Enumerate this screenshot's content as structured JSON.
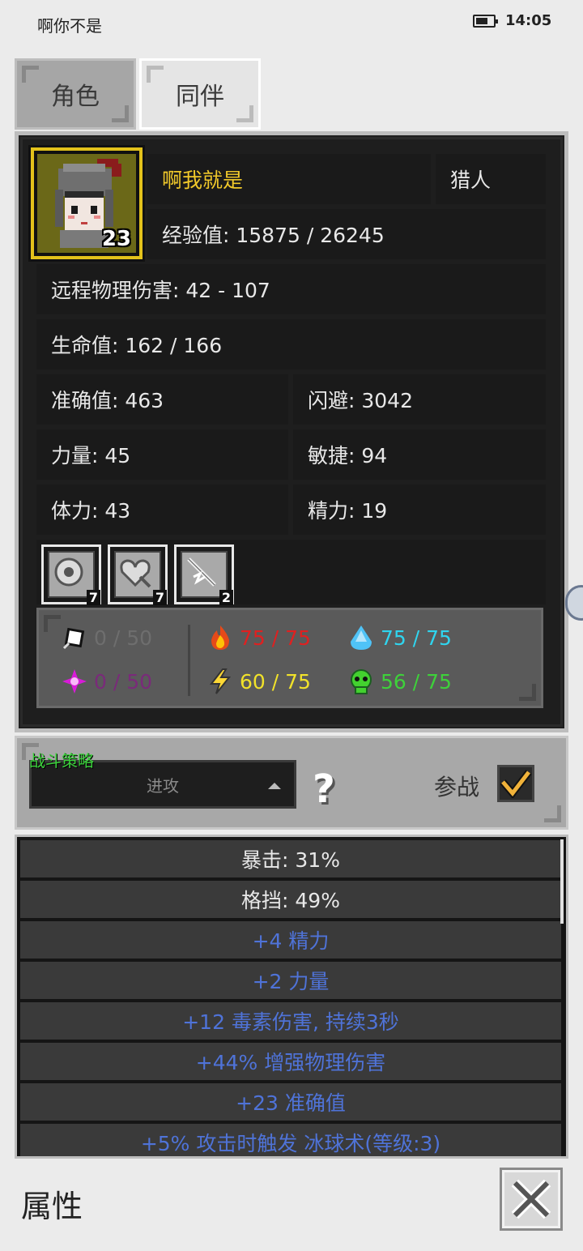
{
  "status_bar": {
    "title": "啊你不是",
    "time": "14:05",
    "battery_pct": 70
  },
  "tabs": [
    {
      "label": "角色",
      "active": false
    },
    {
      "label": "同伴",
      "active": true
    }
  ],
  "hero": {
    "name": "啊我就是",
    "class": "猎人",
    "level": "23",
    "experience": "经验值: 15875 / 26245",
    "ranged_damage": "远程物理伤害: 42 - 107",
    "hp": "生命值: 162 / 166"
  },
  "stats": {
    "accuracy": "准确值: 463",
    "evasion": "闪避: 3042",
    "strength": "力量: 45",
    "agility": "敏捷: 94",
    "vitality": "体力: 43",
    "energy": "精力: 19"
  },
  "skills": [
    {
      "icon": "shield-round-icon",
      "count": "7"
    },
    {
      "icon": "shield-heart-icon",
      "count": "7"
    },
    {
      "icon": "sword-lightning-icon",
      "count": "2"
    }
  ],
  "resistances": {
    "physical": {
      "value": "0 / 50",
      "color": "#6e6e6e"
    },
    "fire": {
      "value": "75 / 75",
      "color": "#e02020"
    },
    "ice": {
      "value": "75 / 75",
      "color": "#2fd5ef"
    },
    "arcane": {
      "value": "0 / 50",
      "color": "#7a2a7a"
    },
    "lightning": {
      "value": "60 / 75",
      "color": "#f1e22a"
    },
    "poison": {
      "value": "56 / 75",
      "color": "#3ed13a"
    }
  },
  "strategy": {
    "label": "战斗策略",
    "selected": "进攻",
    "help": "?",
    "join_label": "参战",
    "join_checked": true
  },
  "properties": [
    {
      "text": "暴击: 31%",
      "color": "#e8e8e8"
    },
    {
      "text": "格挡: 49%",
      "color": "#e8e8e8"
    },
    {
      "text": "+4 精力",
      "color": "#4f73d8"
    },
    {
      "text": "+2 力量",
      "color": "#4f73d8"
    },
    {
      "text": "+12 毒素伤害, 持续3秒",
      "color": "#4f73d8"
    },
    {
      "text": "+44% 增强物理伤害",
      "color": "#4f73d8"
    },
    {
      "text": "+23 准确值",
      "color": "#4f73d8"
    },
    {
      "text": "+5% 攻击时触发 冰球术(等级:3)",
      "color": "#4f73d8"
    }
  ],
  "footer": {
    "title": "属性"
  }
}
